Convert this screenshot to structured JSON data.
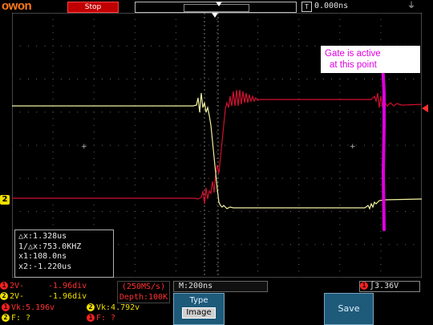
{
  "header": {
    "logo_text": "owon",
    "run_status": "Stop",
    "trigger_offset": "0.000ns",
    "trigger_offset_icon": "T"
  },
  "cursor_readout": {
    "delta_x": "△x:1.328us",
    "inv_delta_x": "1/△x:753.0KHZ",
    "x1": "x1:108.0ns",
    "x2": "x2:-1.220us"
  },
  "channels": {
    "ch1": {
      "badge": "1",
      "coupling": "2V-",
      "offset": "-1.96div",
      "color": "#ff3030"
    },
    "ch2": {
      "badge": "2",
      "coupling": "2V-",
      "offset": "-1.96div",
      "color": "#f0e000"
    }
  },
  "acquisition": {
    "sample_rate": "(250MS/s)",
    "depth": "Depth:100K"
  },
  "timebase": {
    "label": "M:200ns"
  },
  "trigger": {
    "badge": "1",
    "level": "3.36V"
  },
  "measurements": {
    "ch1_vk": "Vk:5.196v",
    "ch2_vk": "Vk:4.792v",
    "ch2_f": "F: ?",
    "ch1_f": "F: ?"
  },
  "menu": {
    "type_label": "Type",
    "type_value": "Image",
    "save_label": "Save"
  },
  "annotation": {
    "line1": "Gate is active",
    "line2": "at this point",
    "color": "#e000e0"
  },
  "colors": {
    "ch1": "#ff3030",
    "ch2": "#f0e000",
    "annotation": "#e000e0"
  }
}
